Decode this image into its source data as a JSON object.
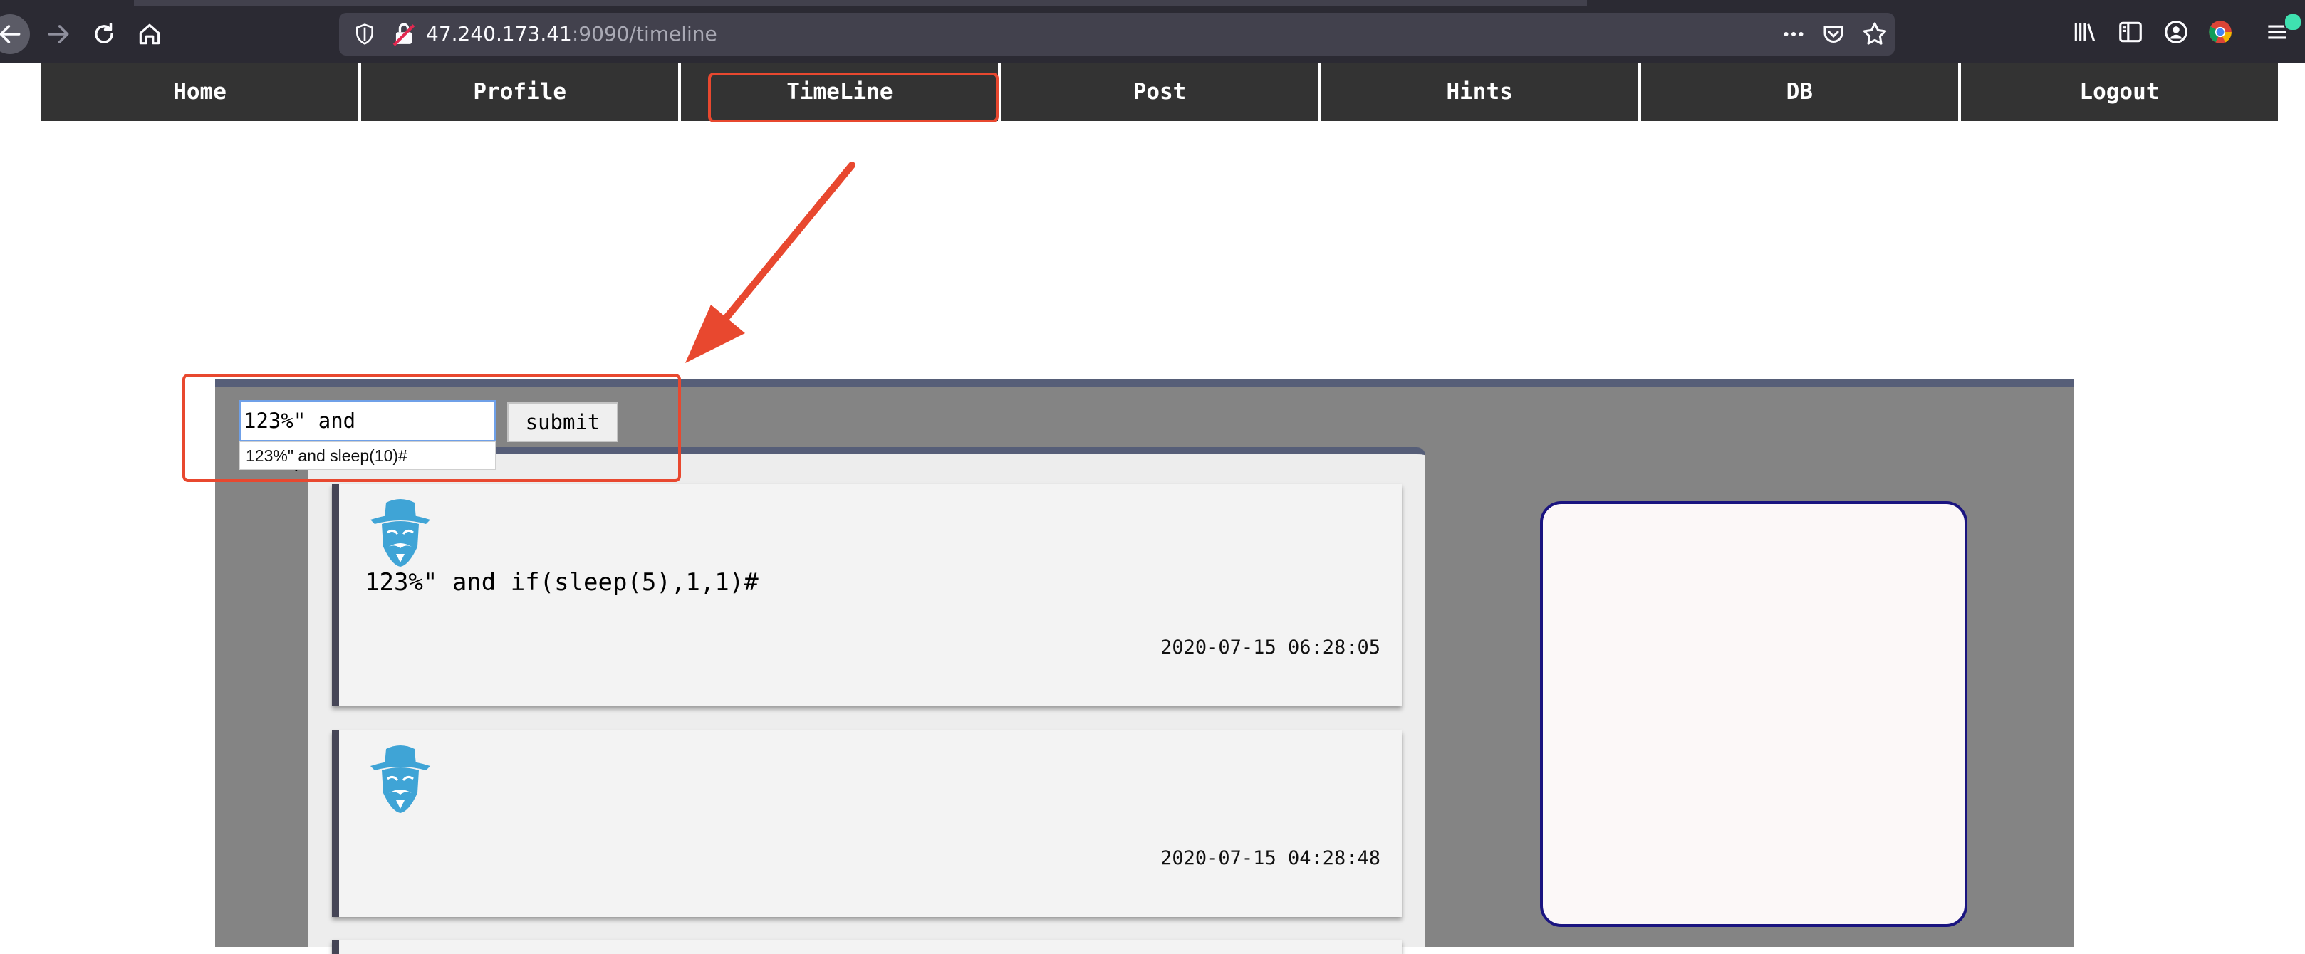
{
  "browser": {
    "url_host": "47.240.173.41",
    "url_rest": ":9090/timeline"
  },
  "nav": {
    "items": [
      "Home",
      "Profile",
      "TimeLine",
      "Post",
      "Hints",
      "DB",
      "Logout"
    ]
  },
  "search": {
    "value": "123%\" and sleep(10)#",
    "suggestion": "123%\" and sleep(10)#",
    "submit_label": "submit"
  },
  "posts": [
    {
      "text": "123%\" and if(sleep(5),1,1)#",
      "time": "2020-07-15 06:28:05"
    },
    {
      "text": "",
      "time": "2020-07-15 04:28:48"
    }
  ],
  "colors": {
    "annotation": "#e8482f",
    "avatar": "#3fa4d6",
    "panel": "#848484",
    "panel_border": "#565e78",
    "side_box_border": "#1a1480"
  },
  "icons": [
    "back-icon",
    "forward-icon",
    "reload-icon",
    "home-icon",
    "shield-icon",
    "lock-insecure-icon",
    "more-icon",
    "pocket-icon",
    "star-icon",
    "library-icon",
    "sidebar-icon",
    "account-icon",
    "chrome-icon",
    "menu-icon",
    "avatar-icon"
  ]
}
